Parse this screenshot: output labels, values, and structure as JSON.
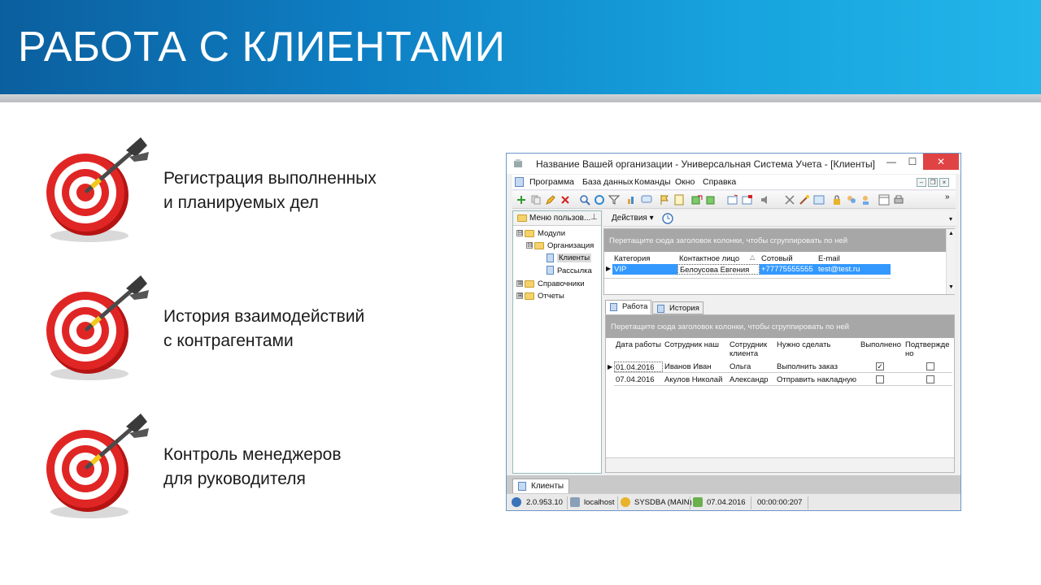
{
  "slide": {
    "title": "РАБОТА С КЛИЕНТАМИ",
    "bullets": [
      {
        "line1": "Регистрация выполненных",
        "line2": "и планируемых дел"
      },
      {
        "line1": "История взаимодействий",
        "line2": "с контрагентами"
      },
      {
        "line1": "Контроль менеджеров",
        "line2": "для руководителя"
      }
    ],
    "colors": {
      "banner_dark": "#0b5f9e",
      "banner_light": "#22b6ea",
      "target_red": "#d8201f"
    }
  },
  "app": {
    "title": "Название Вашей организации - Универсальная Система Учета - [Клиенты]",
    "window_buttons": {
      "minimize": "—",
      "maximize": "☐",
      "close": "✕"
    },
    "menu": [
      "Программа",
      "База данных",
      "Команды",
      "Окно",
      "Справка"
    ],
    "left_panel": {
      "header": "Меню пользов...",
      "tree": [
        {
          "label": "Модули",
          "expander": "⊟"
        },
        {
          "label": "Организация",
          "expander": "⊟"
        },
        {
          "label": "Клиенты"
        },
        {
          "label": "Рассылка"
        },
        {
          "label": "Справочники",
          "expander": "⊞"
        },
        {
          "label": "Отчеты",
          "expander": "⊞"
        }
      ]
    },
    "actions_label": "Действия",
    "clients_grid": {
      "group_hint": "Перетащите сюда заголовок колонки, чтобы сгруппировать по ней",
      "columns": [
        "Категория",
        "Контактное лицо",
        "Сотовый",
        "E-mail"
      ],
      "rows": [
        {
          "category": "VIP",
          "contact": "Белоусова Евгения",
          "phone": "+77775555555",
          "email": "test@test.ru"
        }
      ]
    },
    "tabs": [
      {
        "label": "Работа",
        "active": true
      },
      {
        "label": "История",
        "active": false
      }
    ],
    "work_grid": {
      "group_hint": "Перетащите сюда заголовок колонки, чтобы сгруппировать по ней",
      "columns": {
        "date": "Дата работы",
        "employee": "Сотрудник наш",
        "client_emp_1": "Сотрудник",
        "client_emp_2": "клиента",
        "todo": "Нужно сделать",
        "done": "Выполнено",
        "confirmed_1": "Подтвержде",
        "confirmed_2": "но"
      },
      "rows": [
        {
          "date": "01.04.2016",
          "employee": "Иванов Иван",
          "client_emp": "Ольга",
          "todo": "Выполнить заказ",
          "done": true,
          "confirmed": false
        },
        {
          "date": "07.04.2016",
          "employee": "Акулов Николай",
          "client_emp": "Александр",
          "todo": "Отправить накладную",
          "done": false,
          "confirmed": false
        }
      ]
    },
    "bottom_tab": "Клиенты",
    "status": {
      "version": "2.0.953.10",
      "host": "localhost",
      "user": "SYSDBA (MAIN)",
      "date": "07.04.2016",
      "timer": "00:00:00:207"
    }
  }
}
